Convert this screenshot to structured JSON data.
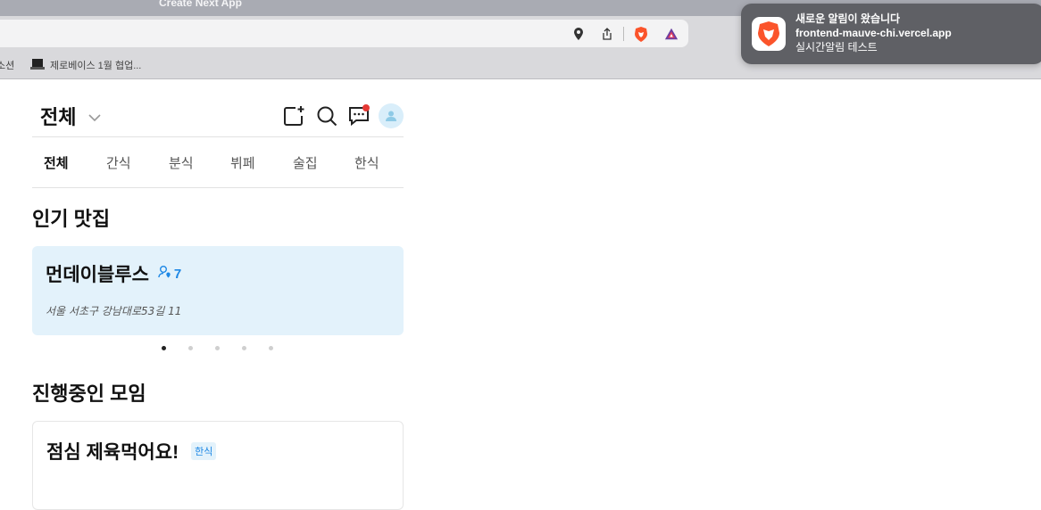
{
  "browser": {
    "window_title": "Create Next App",
    "bookmarks": [
      {
        "label": "소션",
        "icon": "none"
      },
      {
        "label": "제로베이스 1월 협업...",
        "icon": "laptop-icon"
      }
    ]
  },
  "notification": {
    "title": "새로운 알림이 왔습니다",
    "subtitle": "frontend-mauve-chi.vercel.app",
    "body": "실시간알림 테스트",
    "icon": "brave-lion-icon"
  },
  "header": {
    "category_label": "전체",
    "icons": [
      "new-post-icon",
      "search-icon",
      "chat-icon",
      "avatar"
    ]
  },
  "tabs": [
    {
      "label": "전체",
      "active": true
    },
    {
      "label": "간식",
      "active": false
    },
    {
      "label": "분식",
      "active": false
    },
    {
      "label": "뷔페",
      "active": false
    },
    {
      "label": "술집",
      "active": false
    },
    {
      "label": "한식",
      "active": false
    }
  ],
  "popular": {
    "section_title": "인기 맛집",
    "card": {
      "name": "먼데이블루스",
      "count": "7",
      "address": "서울 서초구 강남대로53길 11"
    },
    "carousel": {
      "total": 5,
      "active_index": 0
    }
  },
  "meetings": {
    "section_title": "진행중인 모임",
    "card": {
      "title": "점심 제육먹어요!",
      "badge": "한식"
    }
  },
  "colors": {
    "accent": "#1e88e5",
    "card_bg": "#e3f2fb",
    "notification_dot": "#e53935",
    "brave_orange": "#fb542b"
  }
}
